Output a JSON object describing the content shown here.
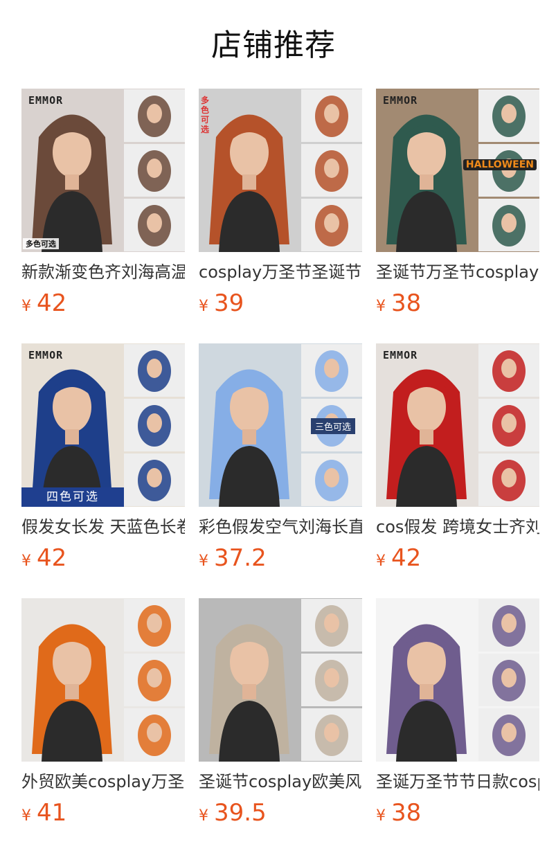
{
  "page": {
    "title": "店铺推荐"
  },
  "products": [
    {
      "name": "新款渐变色齐刘海高温丝长直发",
      "currency": "¥",
      "price": "42",
      "brand": "EMMOR",
      "badge": "多色可选",
      "hair": "#6b4a3a",
      "bg": "#d9d2cf"
    },
    {
      "name": "cosplay万圣节圣诞节假发",
      "currency": "¥",
      "price": "39",
      "brand": "",
      "badge": "多色可选",
      "hair": "#b5522a",
      "bg": "#cfcfcf"
    },
    {
      "name": "圣诞节万圣节cosplay假发",
      "currency": "¥",
      "price": "38",
      "brand": "EMMOR",
      "badge": "HALLOWEEN",
      "hair": "#2f5a4e",
      "bg": "#a28a72"
    },
    {
      "name": "假发女长发 天蓝色长卷发",
      "currency": "¥",
      "price": "42",
      "brand": "EMMOR",
      "badge": "四色可选",
      "hair": "#1e3f8a",
      "bg": "#e7e0d6"
    },
    {
      "name": "彩色假发空气刘海长直发",
      "currency": "¥",
      "price": "37.2",
      "brand": "",
      "badge": "三色可选",
      "hair": "#86aee6",
      "bg": "#cfd8df"
    },
    {
      "name": "cos假发 跨境女士齐刘海",
      "currency": "¥",
      "price": "42",
      "brand": "EMMOR",
      "badge": "",
      "hair": "#c21e1e",
      "bg": "#e5e0dc"
    },
    {
      "name": "外贸欧美cosplay万圣节假发",
      "currency": "¥",
      "price": "41",
      "brand": "",
      "badge": "",
      "hair": "#e06a1a",
      "bg": "#e9e7e4"
    },
    {
      "name": "圣诞节cosplay欧美风假发",
      "currency": "¥",
      "price": "39.5",
      "brand": "",
      "badge": "",
      "hair": "#bfb2a0",
      "bg": "#b9b9b9"
    },
    {
      "name": "圣诞万圣节节日款cosplay",
      "currency": "¥",
      "price": "38",
      "brand": "",
      "badge": "",
      "hair": "#6f5d8e",
      "bg": "#f4f4f4"
    }
  ]
}
